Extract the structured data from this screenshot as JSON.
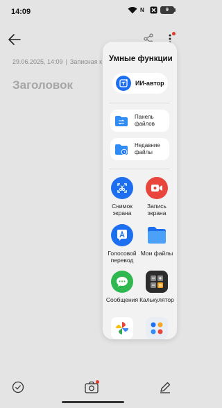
{
  "status": {
    "time": "14:09",
    "battery": "9",
    "network_badge": "N"
  },
  "note": {
    "date": "29.06.2025, 14:09",
    "category": "Записная к",
    "title_placeholder": "Заголовок"
  },
  "panel": {
    "title": "Умные функции",
    "ai_button": "ИИ-автор",
    "pills": [
      {
        "label_1": "Панель",
        "label_2": "файлов",
        "icon": "file-panel-icon"
      },
      {
        "label_1": "Недавние",
        "label_2": "файлы",
        "icon": "recent-files-icon"
      }
    ],
    "apps": [
      {
        "label": "Снимок экрана",
        "icon": "screenshot-icon",
        "color": "#1e6ff0"
      },
      {
        "label": "Запись экрана",
        "icon": "screen-record-icon",
        "color": "#e8453c"
      },
      {
        "label": "Голосовой перевод",
        "icon": "voice-translate-icon",
        "color": "#1e6ff0"
      },
      {
        "label": "Мои файлы",
        "icon": "my-files-icon",
        "color": "#2f8cf5"
      },
      {
        "label": "Сообщения",
        "icon": "messages-icon",
        "color": "#2eb84f"
      },
      {
        "label": "Калькулятор",
        "icon": "calculator-icon",
        "color": "#2c2c2c"
      },
      {
        "label": "",
        "icon": "photos-icon",
        "color": "#ffffff"
      },
      {
        "label": "",
        "icon": "apps-folder-icon",
        "color": "#e9eef5"
      }
    ]
  },
  "colors": {
    "accent": "#1e6ff0",
    "record_red": "#e8453c",
    "notification_dot": "#e03a2e"
  }
}
